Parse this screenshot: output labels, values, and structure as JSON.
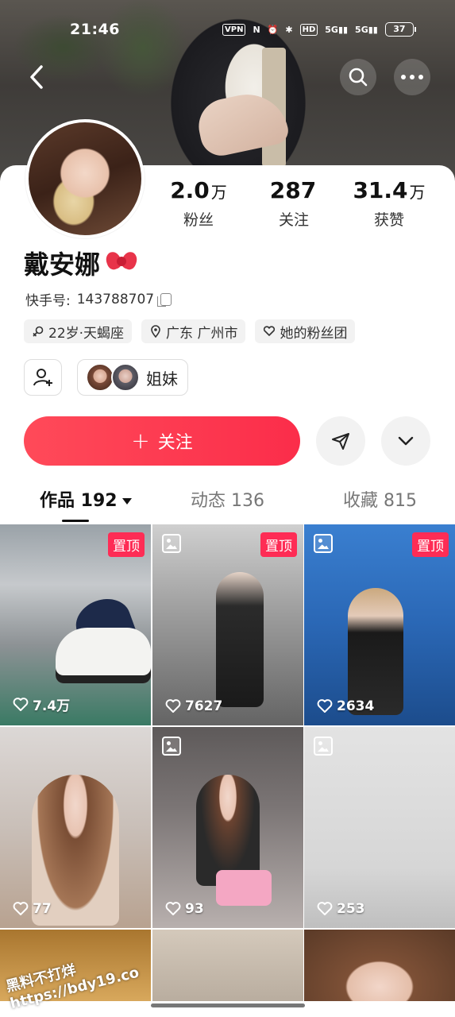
{
  "status_bar": {
    "time": "21:46",
    "vpn": "VPN",
    "net1": "5G",
    "net2": "5G",
    "battery": "37"
  },
  "profile": {
    "name": "戴安娜",
    "kuaishou_id_label": "快手号:",
    "kuaishou_id": "143788707",
    "stats": [
      {
        "num": "2.0",
        "unit": "万",
        "label": "粉丝"
      },
      {
        "num": "287",
        "unit": "",
        "label": "关注"
      },
      {
        "num": "31.4",
        "unit": "万",
        "label": "获赞"
      }
    ],
    "tags": [
      {
        "icon": "gender-icon",
        "label": "22岁·天蝎座"
      },
      {
        "icon": "location-icon",
        "label": "广东 广州市"
      },
      {
        "icon": "fan-club-icon",
        "label": "她的粉丝团"
      }
    ],
    "relation_label": "姐妹"
  },
  "actions": {
    "follow_label": "关注",
    "follow_plus": "+"
  },
  "tabs": [
    {
      "label": "作品 192",
      "active": true
    },
    {
      "label": "动态 136",
      "active": false
    },
    {
      "label": "收藏 815",
      "active": false
    }
  ],
  "grid": [
    {
      "likes": "7.4万",
      "pinned": true,
      "pin_label": "置顶",
      "image_type": false
    },
    {
      "likes": "7627",
      "pinned": true,
      "pin_label": "置顶",
      "image_type": true
    },
    {
      "likes": "2634",
      "pinned": true,
      "pin_label": "置顶",
      "image_type": true
    },
    {
      "likes": "77",
      "pinned": false,
      "image_type": false
    },
    {
      "likes": "93",
      "pinned": false,
      "image_type": true
    },
    {
      "likes": "253",
      "pinned": false,
      "image_type": true
    }
  ],
  "watermark": "黑料不打烊\nhttps://bdy19.co",
  "colors": {
    "accent": "#fe2c55",
    "follow_gradient_start": "#ff4a59",
    "follow_gradient_end": "#fb2d4a"
  }
}
